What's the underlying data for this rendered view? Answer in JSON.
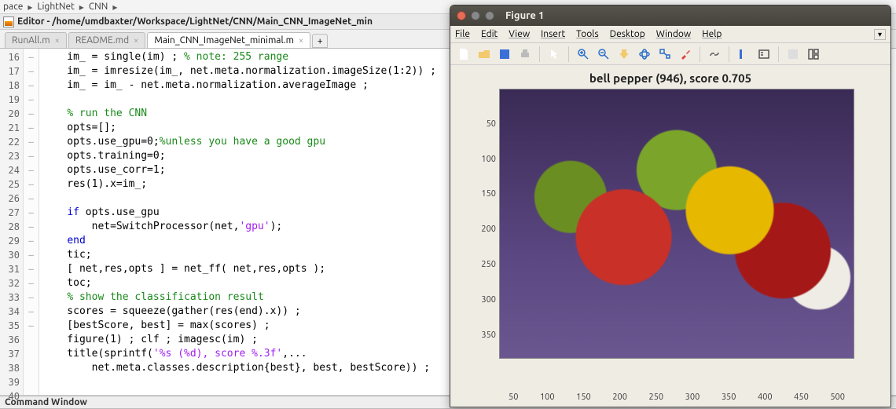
{
  "breadcrumbs": [
    "pace",
    "LightNet",
    "CNN"
  ],
  "editor": {
    "title": "Editor - /home/umdbaxter/Workspace/LightNet/CNN/Main_CNN_ImageNet_min",
    "tabs": [
      {
        "label": "RunAll.m",
        "active": false
      },
      {
        "label": "README.md",
        "active": false
      },
      {
        "label": "Main_CNN_ImageNet_minimal.m",
        "active": true
      }
    ],
    "first_line": 16,
    "marks": [
      "–",
      "–",
      "–",
      "",
      "–",
      "–",
      "–",
      "–",
      "–",
      "–",
      "",
      "–",
      "–",
      "–",
      "–",
      "–",
      "–",
      "",
      "–",
      "–",
      "–",
      "–",
      "–",
      "",
      ""
    ],
    "lines": [
      {
        "ind": 1,
        "parts": [
          [
            "",
            "im_ = single(im) ; "
          ],
          [
            "com",
            "% note: 255 range"
          ]
        ]
      },
      {
        "ind": 1,
        "parts": [
          [
            "",
            "im_ = imresize(im_, net.meta.normalization.imageSize(1:2)) ;"
          ]
        ]
      },
      {
        "ind": 1,
        "parts": [
          [
            "",
            "im_ = im_ - net.meta.normalization.averageImage ;"
          ]
        ]
      },
      {
        "ind": 0,
        "parts": [
          [
            "",
            ""
          ]
        ]
      },
      {
        "ind": 1,
        "parts": [
          [
            "com",
            "% run the CNN"
          ]
        ]
      },
      {
        "ind": 1,
        "parts": [
          [
            "",
            "opts=[];"
          ]
        ]
      },
      {
        "ind": 1,
        "parts": [
          [
            "",
            "opts.use_gpu=0;"
          ],
          [
            "com",
            "%unless you have a good gpu"
          ]
        ]
      },
      {
        "ind": 1,
        "parts": [
          [
            "",
            "opts.training=0;"
          ]
        ]
      },
      {
        "ind": 1,
        "parts": [
          [
            "",
            "opts.use_corr=1;"
          ]
        ]
      },
      {
        "ind": 1,
        "parts": [
          [
            "",
            "res(1).x=im_;"
          ]
        ]
      },
      {
        "ind": 0,
        "parts": [
          [
            "",
            ""
          ]
        ]
      },
      {
        "ind": 1,
        "parts": [
          [
            "kw",
            "if"
          ],
          [
            "",
            " opts.use_gpu"
          ]
        ]
      },
      {
        "ind": 2,
        "parts": [
          [
            "",
            "net=SwitchProcessor(net,"
          ],
          [
            "str",
            "'gpu'"
          ],
          [
            "",
            ");"
          ]
        ]
      },
      {
        "ind": 1,
        "parts": [
          [
            "kw",
            "end"
          ]
        ]
      },
      {
        "ind": 1,
        "parts": [
          [
            "",
            "tic;"
          ]
        ]
      },
      {
        "ind": 1,
        "parts": [
          [
            "",
            "[ net,res,opts ] = net_ff( net,res,opts );"
          ]
        ]
      },
      {
        "ind": 1,
        "parts": [
          [
            "",
            "toc;"
          ]
        ]
      },
      {
        "ind": 1,
        "parts": [
          [
            "com",
            "% show the classification result"
          ]
        ]
      },
      {
        "ind": 1,
        "parts": [
          [
            "",
            "scores = squeeze(gather(res(end).x)) ;"
          ]
        ]
      },
      {
        "ind": 1,
        "parts": [
          [
            "",
            "[bestScore, best] = max(scores) ;"
          ]
        ]
      },
      {
        "ind": 1,
        "parts": [
          [
            "",
            "figure(1) ; clf ; imagesc(im) ;"
          ]
        ]
      },
      {
        "ind": 1,
        "parts": [
          [
            "",
            "title(sprintf("
          ],
          [
            "str",
            "'%s (%d), score %.3f'"
          ],
          [
            "",
            ",..."
          ]
        ]
      },
      {
        "ind": 2,
        "parts": [
          [
            "",
            "net.meta.classes.description{best}, best, bestScore)) ;"
          ]
        ]
      },
      {
        "ind": 0,
        "parts": [
          [
            "",
            ""
          ]
        ]
      },
      {
        "ind": 0,
        "parts": [
          [
            "",
            ""
          ]
        ]
      }
    ]
  },
  "command_window_title": "Command Window",
  "figure": {
    "title": "Figure 1",
    "menus": [
      "File",
      "Edit",
      "View",
      "Insert",
      "Tools",
      "Desktop",
      "Window",
      "Help"
    ],
    "toolbar_icons": [
      "new",
      "open",
      "save",
      "print",
      "sep",
      "pointer",
      "sep",
      "zoom-in",
      "zoom-out",
      "pan",
      "rotate3d",
      "datacursor",
      "brush",
      "sep",
      "link",
      "sep",
      "colorbar",
      "legend",
      "sep",
      "hide",
      "layout"
    ],
    "plot_title": "bell pepper (946), score 0.705",
    "yticks": [
      "50",
      "100",
      "150",
      "200",
      "250",
      "300",
      "350"
    ],
    "xticks": [
      "50",
      "100",
      "150",
      "200",
      "250",
      "300",
      "350",
      "400",
      "450",
      "500"
    ]
  },
  "chart_data": {
    "type": "image",
    "title": "bell pepper (946), score 0.705",
    "class_label": "bell pepper",
    "class_id": 946,
    "score": 0.705,
    "xrange": [
      1,
      512
    ],
    "yrange": [
      1,
      384
    ],
    "xticks": [
      50,
      100,
      150,
      200,
      250,
      300,
      350,
      400,
      450,
      500
    ],
    "yticks": [
      50,
      100,
      150,
      200,
      250,
      300,
      350
    ]
  }
}
